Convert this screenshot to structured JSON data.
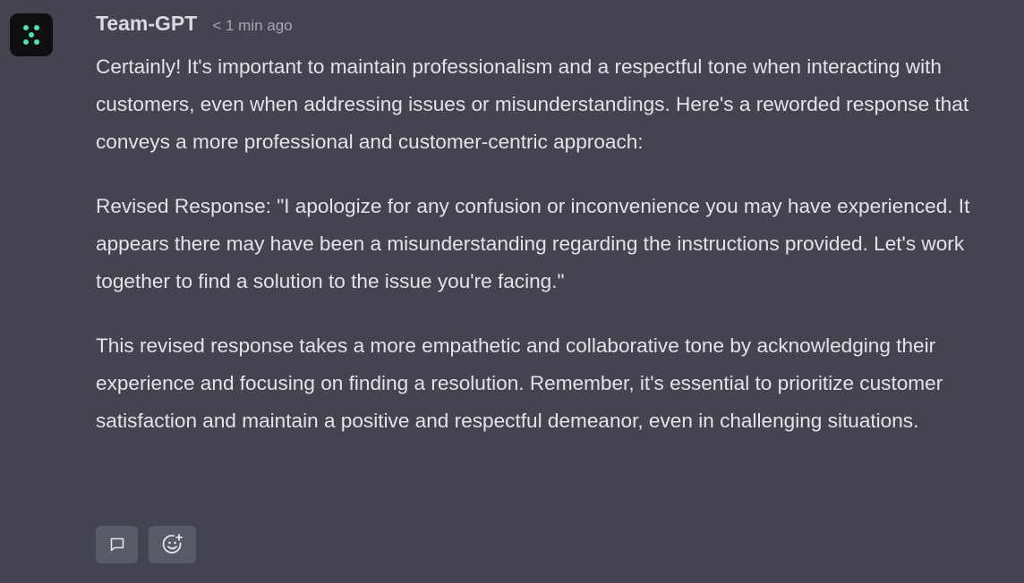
{
  "message": {
    "author": "Team-GPT",
    "timestamp": "< 1 min ago",
    "paragraphs": [
      "Certainly! It's important to maintain professionalism and a respectful tone when interacting with customers, even when addressing issues or misunderstandings. Here's a reworded response that conveys a more professional and customer-centric approach:",
      "Revised Response: \"I apologize for any confusion or inconvenience you may have experienced. It appears there may have been a misunderstanding regarding the instructions provided. Let's work together to find a solution to the issue you're facing.\"",
      "This revised response takes a more empathetic and collaborative tone by acknowledging their experience and focusing on finding a resolution. Remember, it's essential to prioritize customer satisfaction and maintain a positive and respectful demeanor, even in challenging situations."
    ]
  },
  "actions": {
    "comment_icon": "speech-bubble-icon",
    "react_icon": "add-reaction-icon"
  },
  "colors": {
    "background": "#434450",
    "avatar_bg": "#0f0f11",
    "avatar_accent": "#4fe0b0",
    "button_bg": "#585a66"
  }
}
